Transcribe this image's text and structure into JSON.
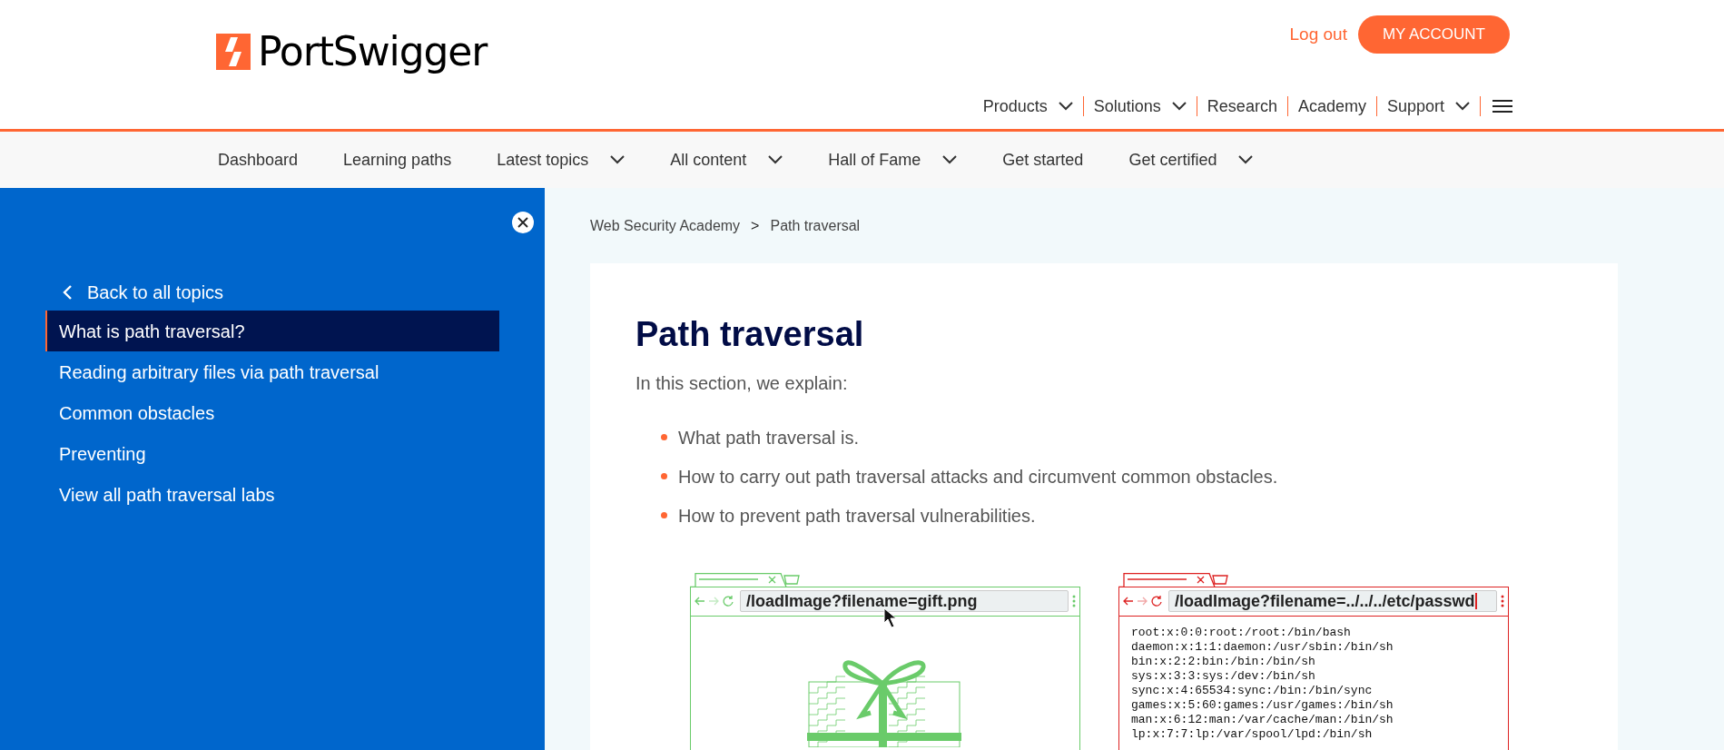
{
  "header": {
    "logo_text": "PortSwigger",
    "logout": "Log out",
    "account_button": "MY ACCOUNT",
    "main_nav": [
      {
        "label": "Products",
        "dropdown": true
      },
      {
        "label": "Solutions",
        "dropdown": true
      },
      {
        "label": "Research",
        "dropdown": false
      },
      {
        "label": "Academy",
        "dropdown": false
      },
      {
        "label": "Support",
        "dropdown": true
      }
    ]
  },
  "sub_nav": [
    {
      "label": "Dashboard",
      "dropdown": false
    },
    {
      "label": "Learning paths",
      "dropdown": false
    },
    {
      "label": "Latest topics",
      "dropdown": true
    },
    {
      "label": "All content",
      "dropdown": true
    },
    {
      "label": "Hall of Fame",
      "dropdown": true
    },
    {
      "label": "Get started",
      "dropdown": false
    },
    {
      "label": "Get certified",
      "dropdown": true
    }
  ],
  "sidebar": {
    "back": "Back to all topics",
    "items": [
      {
        "label": "What is path traversal?",
        "selected": true
      },
      {
        "label": "Reading arbitrary files via path traversal",
        "selected": false
      },
      {
        "label": "Common obstacles",
        "selected": false
      },
      {
        "label": "Preventing",
        "selected": false
      },
      {
        "label": "View all path traversal labs",
        "selected": false
      }
    ]
  },
  "breadcrumb": [
    "Web Security Academy",
    "Path traversal"
  ],
  "breadcrumb_separator": ">",
  "article": {
    "title": "Path traversal",
    "intro": "In this section, we explain:",
    "bullets": [
      "What path traversal is.",
      "How to carry out path traversal attacks and circumvent common obstacles.",
      "How to prevent path traversal vulnerabilities."
    ]
  },
  "illustrations": [
    {
      "kind": "safe",
      "url": "/loadImage?filename=gift.png"
    },
    {
      "kind": "attack",
      "url": "/loadImage?filename=../../../etc/passwd",
      "lines": [
        "root:x:0:0:root:/root:/bin/bash",
        "daemon:x:1:1:daemon:/usr/sbin:/bin/sh",
        "bin:x:2:2:bin:/bin:/bin/sh",
        "sys:x:3:3:sys:/dev:/bin/sh",
        "sync:x:4:65534:sync:/bin:/bin/sync",
        "games:x:5:60:games:/usr/games:/bin/sh",
        "man:x:6:12:man:/var/cache/man:/bin/sh",
        "lp:x:7:7:lp:/var/spool/lpd:/bin/sh"
      ]
    }
  ]
}
